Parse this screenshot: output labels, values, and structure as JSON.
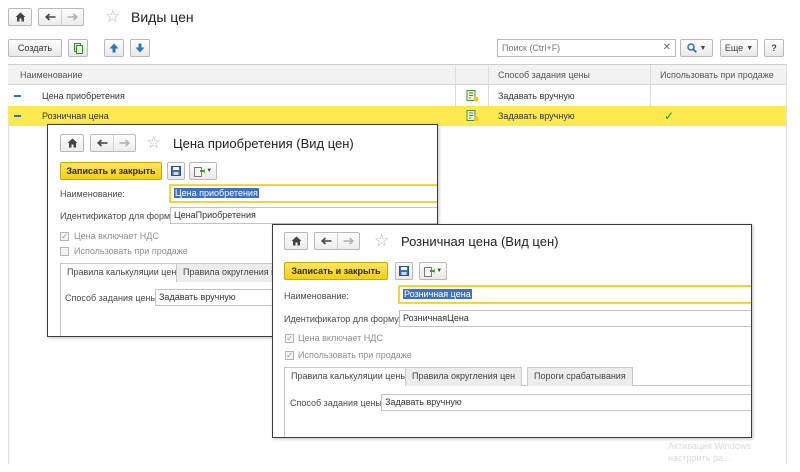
{
  "main": {
    "title": "Виды цен",
    "toolbar": {
      "create_label": "Создать",
      "search_placeholder": "Поиск (Ctrl+F)",
      "more_label": "Еще",
      "help_label": "?"
    },
    "columns": [
      "Наименование",
      "Способ задания цены",
      "Использовать при продаже"
    ],
    "rows": [
      {
        "name": "Цена приобретения",
        "method": "Задавать вручную",
        "use_in_sale": ""
      },
      {
        "name": "Розничная цена",
        "method": "Задавать вручную",
        "use_in_sale": "✓"
      }
    ]
  },
  "dialog1": {
    "title": "Цена приобретения (Вид цен)",
    "save_label": "Записать и закрыть",
    "name_label": "Наименование:",
    "name_value": "Цена приобретения",
    "formula_label": "Идентификатор для формул:",
    "formula_value": "ЦенаПриобретения",
    "vat_label": "Цена включает НДС",
    "sale_label": "Использовать при продаже",
    "tabs": [
      "Правила калькуляции цены",
      "Правила округления цен"
    ],
    "method_label": "Способ задания цены:",
    "method_value": "Задавать вручную"
  },
  "dialog2": {
    "title": "Розничная цена (Вид цен)",
    "save_label": "Записать и закрыть",
    "name_label": "Наименование:",
    "name_value": "Розничная цена",
    "formula_label": "Идентификатор для формул:",
    "formula_value": "РозничнаяЦена",
    "vat_label": "Цена включает НДС",
    "sale_label": "Использовать при продаже",
    "tabs": [
      "Правила калькуляции цены",
      "Правила округления цен",
      "Пороги срабатывания"
    ],
    "method_label": "Способ задания цены:",
    "method_value": "Задавать вручную"
  },
  "watermark": {
    "line1": "Активация Windows",
    "line2": "настроить ра..."
  },
  "colors": {
    "accent_yellow": "#fbe94e",
    "button_yellow": "#f3cf12",
    "selection_blue": "#3d6fc2",
    "check_green": "#2f8f1f"
  },
  "icons": [
    "home-icon",
    "arrow-left-icon",
    "arrow-right-icon",
    "star-icon",
    "copy-icon",
    "arrow-up-icon",
    "arrow-down-icon",
    "search-icon",
    "chevron-down-icon",
    "close-icon",
    "save-icon",
    "create-based-on-icon",
    "calculator-icon",
    "checkmark-icon"
  ]
}
